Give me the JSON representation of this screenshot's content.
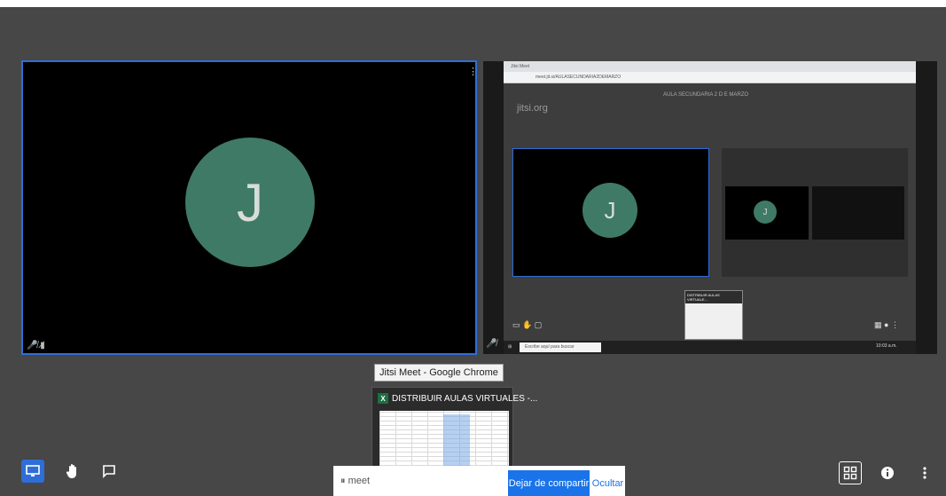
{
  "tiles": {
    "left": {
      "avatar_initial": "J"
    },
    "right": {
      "browser_tab_title": "Jitsi Meet",
      "address": "meet.jit.si/AULASECUNDARIA2DEMARZO",
      "logo_text": "jitsi.org",
      "room_title": "AULA SECUNDARIA 2 D E MARZO",
      "inner_avatar_initial": "J",
      "inner_small_avatar_initial": "J",
      "excel_preview_title": "DISTRIBUIR AULAS VIRTUALE...",
      "taskbar_search_placeholder": "Escribe aquí para buscar",
      "taskbar_time": "10:03 a.m."
    }
  },
  "taskbar_tooltip": "Jitsi Meet - Google Chrome",
  "window_preview": {
    "title": "DISTRIBUIR AULAS VIRTUALES -...",
    "app_icon": "excel-icon",
    "icon_letter": "X"
  },
  "share_bar": {
    "text": "meet",
    "stop_label": "Dejar de compartir",
    "hide_label": "Ocultar"
  },
  "toolbar": {
    "left": [
      "screen-share-icon",
      "raise-hand-icon",
      "chat-icon"
    ],
    "right": [
      "tile-view-icon",
      "info-icon",
      "more-icon"
    ]
  },
  "colors": {
    "background": "#474747",
    "accent": "#2f6ed8",
    "avatar": "#3f7a66",
    "share_button": "#1a73e8"
  }
}
